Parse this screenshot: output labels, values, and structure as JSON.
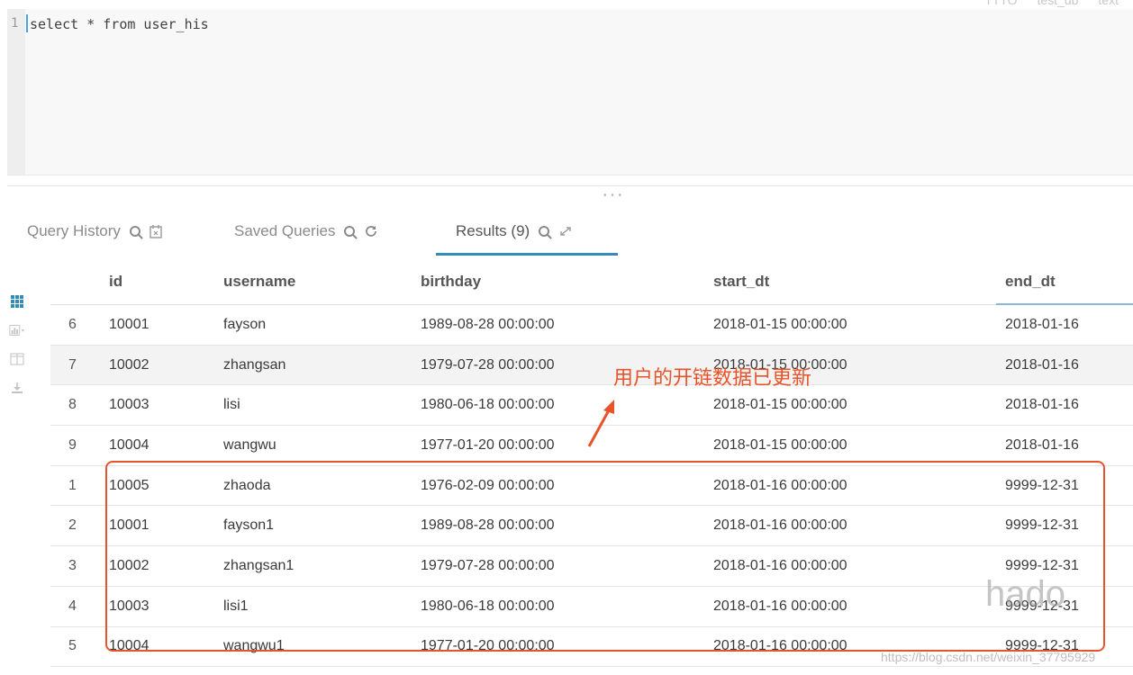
{
  "top_meta": [
    "TTTO",
    "test_db",
    "text"
  ],
  "editor": {
    "line_number": "1",
    "query": "select * from user_his"
  },
  "tabs": [
    {
      "label": "Query History"
    },
    {
      "label": "Saved Queries"
    },
    {
      "label": "Results (9)"
    }
  ],
  "table": {
    "columns": [
      "id",
      "username",
      "birthday",
      "start_dt",
      "end_dt"
    ],
    "rows": [
      {
        "idx": "6",
        "id": "10001",
        "username": "fayson",
        "birthday": "1989-08-28 00:00:00",
        "start_dt": "2018-01-15 00:00:00",
        "end_dt": "2018-01-16"
      },
      {
        "idx": "7",
        "id": "10002",
        "username": "zhangsan",
        "birthday": "1979-07-28 00:00:00",
        "start_dt": "2018-01-15 00:00:00",
        "end_dt": "2018-01-16"
      },
      {
        "idx": "8",
        "id": "10003",
        "username": "lisi",
        "birthday": "1980-06-18 00:00:00",
        "start_dt": "2018-01-15 00:00:00",
        "end_dt": "2018-01-16"
      },
      {
        "idx": "9",
        "id": "10004",
        "username": "wangwu",
        "birthday": "1977-01-20 00:00:00",
        "start_dt": "2018-01-15 00:00:00",
        "end_dt": "2018-01-16"
      },
      {
        "idx": "1",
        "id": "10005",
        "username": "zhaoda",
        "birthday": "1976-02-09 00:00:00",
        "start_dt": "2018-01-16 00:00:00",
        "end_dt": "9999-12-31"
      },
      {
        "idx": "2",
        "id": "10001",
        "username": "fayson1",
        "birthday": "1989-08-28 00:00:00",
        "start_dt": "2018-01-16 00:00:00",
        "end_dt": "9999-12-31"
      },
      {
        "idx": "3",
        "id": "10002",
        "username": "zhangsan1",
        "birthday": "1979-07-28 00:00:00",
        "start_dt": "2018-01-16 00:00:00",
        "end_dt": "9999-12-31"
      },
      {
        "idx": "4",
        "id": "10003",
        "username": "lisi1",
        "birthday": "1980-06-18 00:00:00",
        "start_dt": "2018-01-16 00:00:00",
        "end_dt": "9999-12-31"
      },
      {
        "idx": "5",
        "id": "10004",
        "username": "wangwu1",
        "birthday": "1977-01-20 00:00:00",
        "start_dt": "2018-01-16 00:00:00",
        "end_dt": "9999-12-31"
      }
    ]
  },
  "annotation": {
    "text": "用户的开链数据已更新",
    "color": "#e8542a"
  },
  "watermark": {
    "logo": "hado",
    "url": "https://blog.csdn.net/weixin_37795929"
  },
  "colors": {
    "accent": "#338bb8",
    "annotation": "#e8542a"
  }
}
